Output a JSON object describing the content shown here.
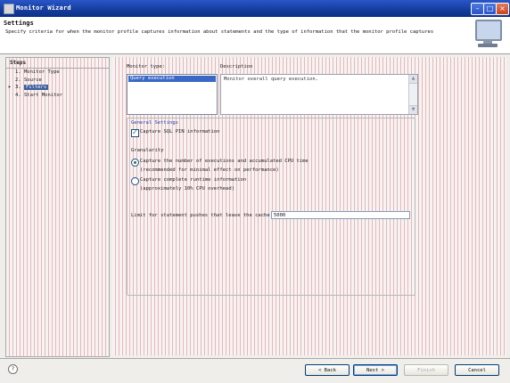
{
  "window": {
    "title": "Monitor Wizard"
  },
  "header": {
    "title": "Settings",
    "description": "Specify criteria for when the monitor profile captures information about statements and the type of information that the monitor profile captures"
  },
  "steps": {
    "header": "Steps",
    "items": [
      {
        "num": "1.",
        "label": "Monitor Type",
        "current": false
      },
      {
        "num": "2.",
        "label": "Source",
        "current": false
      },
      {
        "num": "3.",
        "label": "Filters",
        "current": true
      },
      {
        "num": "4.",
        "label": "Start Monitor",
        "current": false
      }
    ]
  },
  "monitor_type": {
    "label": "Monitor type:",
    "items": [
      "Query execution"
    ],
    "selected": "Query execution"
  },
  "description_box": {
    "label": "Description",
    "text": "Monitor overall query execution."
  },
  "general_settings": {
    "title": "General Settings",
    "capture_sql": {
      "label": "Capture SQL PIN information",
      "checked": true
    },
    "granularity": {
      "label": "Granularity",
      "options": [
        {
          "line1": "Capture the number of executions and accumulated CPU time",
          "line2": "(recommended for minimal effect on performance)",
          "selected": true
        },
        {
          "line1": "Capture complete runtime information",
          "line2": "(approximately 10% CPU overhead)",
          "selected": false
        }
      ]
    },
    "limit": {
      "label": "Limit for statement pushes that leave the cache",
      "value": "5000"
    }
  },
  "buttons": {
    "back": "< Back",
    "next": "Next >",
    "finish": "Finish",
    "cancel": "Cancel",
    "help": "?"
  },
  "colors": {
    "titlebar": "#153f9e",
    "selection": "#3a68c4",
    "group_title": "#1a3fa8"
  },
  "icons": [
    "app-icon",
    "minimize-icon",
    "maximize-icon",
    "close-icon",
    "monitor-icon",
    "help-icon",
    "checkbox-check-icon",
    "radio-dot-icon"
  ]
}
